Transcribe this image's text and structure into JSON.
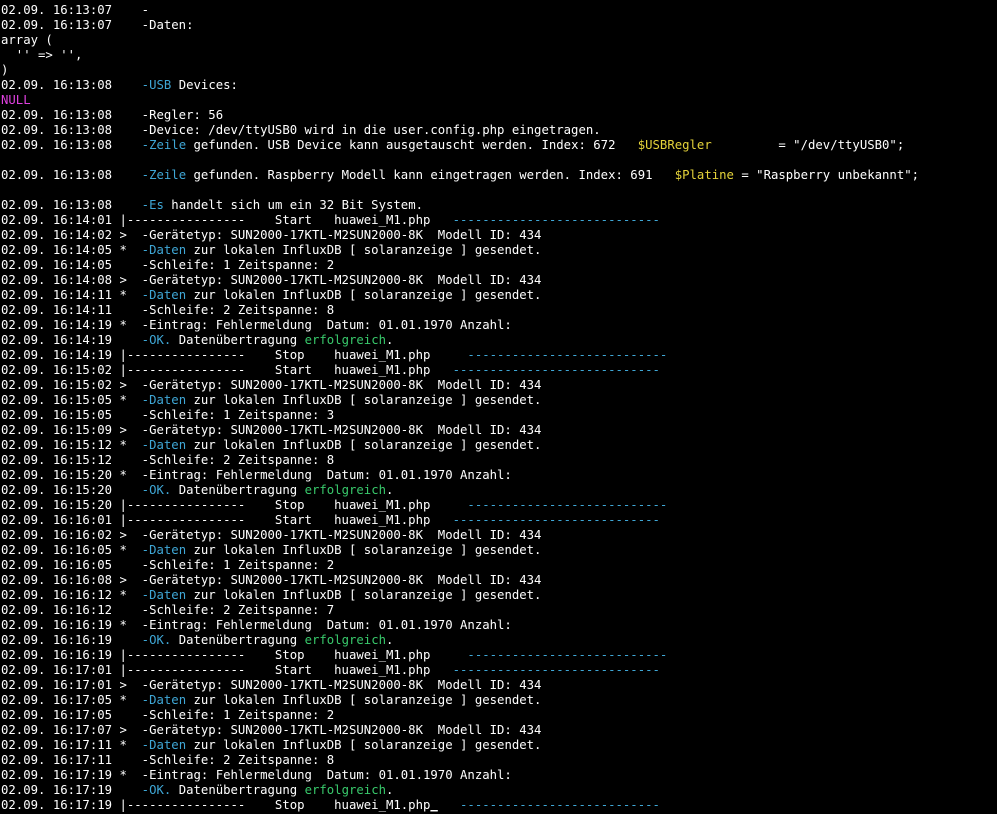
{
  "colors": {
    "background": "#000000",
    "text": "#ffffff",
    "cyan": "#3fa7d6",
    "green": "#38c96b",
    "yellow": "#e5d33a",
    "magenta": "#e040e0"
  },
  "lines": [
    [
      [
        "02.09. 16:13:07    -",
        "white"
      ]
    ],
    [
      [
        "02.09. 16:13:07    -Daten:",
        "white"
      ]
    ],
    [
      [
        "array (",
        "white"
      ]
    ],
    [
      [
        "  '' => '',",
        "white"
      ]
    ],
    [
      [
        ")",
        "white"
      ]
    ],
    [
      [
        "02.09. 16:13:08    ",
        "white"
      ],
      [
        "-USB",
        "cyan"
      ],
      [
        " Devices:",
        "white"
      ]
    ],
    [
      [
        "NULL",
        "magenta"
      ]
    ],
    [
      [
        "02.09. 16:13:08    -Regler: 56",
        "white"
      ]
    ],
    [
      [
        "02.09. 16:13:08    -Device: /dev/ttyUSB0 wird in die user.config.php eingetragen.",
        "white"
      ]
    ],
    [
      [
        "02.09. 16:13:08    ",
        "white"
      ],
      [
        "-Zeile",
        "cyan"
      ],
      [
        " gefunden. USB Device kann ausgetauscht werden. Index: 672   ",
        "white"
      ],
      [
        "$USBRegler",
        "yellow"
      ],
      [
        "         = \"/dev/ttyUSB0\";",
        "white"
      ]
    ],
    [
      [
        "",
        "white"
      ]
    ],
    [
      [
        "02.09. 16:13:08    ",
        "white"
      ],
      [
        "-Zeile",
        "cyan"
      ],
      [
        " gefunden. Raspberry Modell kann eingetragen werden. Index: 691   ",
        "white"
      ],
      [
        "$Platine",
        "yellow"
      ],
      [
        " = \"Raspberry unbekannt\";",
        "white"
      ]
    ],
    [
      [
        "",
        "white"
      ]
    ],
    [
      [
        "02.09. 16:13:08    ",
        "white"
      ],
      [
        "-Es",
        "cyan"
      ],
      [
        " handelt sich um ein 32 Bit System.",
        "white"
      ]
    ],
    [
      [
        "02.09. 16:14:01 |----------------    Start   huawei_M1.php   ",
        "white"
      ],
      [
        "----------------------------",
        "cyan"
      ]
    ],
    [
      [
        "02.09. 16:14:02 >  -Gerätetyp: SUN2000-17KTL-M2SUN2000-8K  Modell ID: 434",
        "white"
      ]
    ],
    [
      [
        "02.09. 16:14:05 *  ",
        "white"
      ],
      [
        "-Daten",
        "cyan"
      ],
      [
        " zur lokalen InfluxDB [ solaranzeige ] gesendet.",
        "white"
      ]
    ],
    [
      [
        "02.09. 16:14:05    -Schleife: 1 Zeitspanne: 2",
        "white"
      ]
    ],
    [
      [
        "02.09. 16:14:08 >  -Gerätetyp: SUN2000-17KTL-M2SUN2000-8K  Modell ID: 434",
        "white"
      ]
    ],
    [
      [
        "02.09. 16:14:11 *  ",
        "white"
      ],
      [
        "-Daten",
        "cyan"
      ],
      [
        " zur lokalen InfluxDB [ solaranzeige ] gesendet.",
        "white"
      ]
    ],
    [
      [
        "02.09. 16:14:11    -Schleife: 2 Zeitspanne: 8",
        "white"
      ]
    ],
    [
      [
        "02.09. 16:14:19 *  -Eintrag: Fehlermeldung  Datum: 01.01.1970 Anzahl:",
        "white"
      ]
    ],
    [
      [
        "02.09. 16:14:19    ",
        "white"
      ],
      [
        "-OK.",
        "cyan"
      ],
      [
        " Datenübertragung ",
        "white"
      ],
      [
        "erfolgreich",
        "green"
      ],
      [
        ".",
        "white"
      ]
    ],
    [
      [
        "02.09. 16:14:19 |----------------    Stop    huawei_M1.php     ",
        "white"
      ],
      [
        "---------------------------",
        "cyan"
      ]
    ],
    [
      [
        "02.09. 16:15:02 |----------------    Start   huawei_M1.php   ",
        "white"
      ],
      [
        "----------------------------",
        "cyan"
      ]
    ],
    [
      [
        "02.09. 16:15:02 >  -Gerätetyp: SUN2000-17KTL-M2SUN2000-8K  Modell ID: 434",
        "white"
      ]
    ],
    [
      [
        "02.09. 16:15:05 *  ",
        "white"
      ],
      [
        "-Daten",
        "cyan"
      ],
      [
        " zur lokalen InfluxDB [ solaranzeige ] gesendet.",
        "white"
      ]
    ],
    [
      [
        "02.09. 16:15:05    -Schleife: 1 Zeitspanne: 3",
        "white"
      ]
    ],
    [
      [
        "02.09. 16:15:09 >  -Gerätetyp: SUN2000-17KTL-M2SUN2000-8K  Modell ID: 434",
        "white"
      ]
    ],
    [
      [
        "02.09. 16:15:12 *  ",
        "white"
      ],
      [
        "-Daten",
        "cyan"
      ],
      [
        " zur lokalen InfluxDB [ solaranzeige ] gesendet.",
        "white"
      ]
    ],
    [
      [
        "02.09. 16:15:12    -Schleife: 2 Zeitspanne: 8",
        "white"
      ]
    ],
    [
      [
        "02.09. 16:15:20 *  -Eintrag: Fehlermeldung  Datum: 01.01.1970 Anzahl:",
        "white"
      ]
    ],
    [
      [
        "02.09. 16:15:20    ",
        "white"
      ],
      [
        "-OK.",
        "cyan"
      ],
      [
        " Datenübertragung ",
        "white"
      ],
      [
        "erfolgreich",
        "green"
      ],
      [
        ".",
        "white"
      ]
    ],
    [
      [
        "02.09. 16:15:20 |----------------    Stop    huawei_M1.php     ",
        "white"
      ],
      [
        "---------------------------",
        "cyan"
      ]
    ],
    [
      [
        "02.09. 16:16:01 |----------------    Start   huawei_M1.php   ",
        "white"
      ],
      [
        "----------------------------",
        "cyan"
      ]
    ],
    [
      [
        "02.09. 16:16:02 >  -Gerätetyp: SUN2000-17KTL-M2SUN2000-8K  Modell ID: 434",
        "white"
      ]
    ],
    [
      [
        "02.09. 16:16:05 *  ",
        "white"
      ],
      [
        "-Daten",
        "cyan"
      ],
      [
        " zur lokalen InfluxDB [ solaranzeige ] gesendet.",
        "white"
      ]
    ],
    [
      [
        "02.09. 16:16:05    -Schleife: 1 Zeitspanne: 2",
        "white"
      ]
    ],
    [
      [
        "02.09. 16:16:08 >  -Gerätetyp: SUN2000-17KTL-M2SUN2000-8K  Modell ID: 434",
        "white"
      ]
    ],
    [
      [
        "02.09. 16:16:12 *  ",
        "white"
      ],
      [
        "-Daten",
        "cyan"
      ],
      [
        " zur lokalen InfluxDB [ solaranzeige ] gesendet.",
        "white"
      ]
    ],
    [
      [
        "02.09. 16:16:12    -Schleife: 2 Zeitspanne: 7",
        "white"
      ]
    ],
    [
      [
        "02.09. 16:16:19 *  -Eintrag: Fehlermeldung  Datum: 01.01.1970 Anzahl:",
        "white"
      ]
    ],
    [
      [
        "02.09. 16:16:19    ",
        "white"
      ],
      [
        "-OK.",
        "cyan"
      ],
      [
        " Datenübertragung ",
        "white"
      ],
      [
        "erfolgreich",
        "green"
      ],
      [
        ".",
        "white"
      ]
    ],
    [
      [
        "02.09. 16:16:19 |----------------    Stop    huawei_M1.php     ",
        "white"
      ],
      [
        "---------------------------",
        "cyan"
      ]
    ],
    [
      [
        "02.09. 16:17:01 |----------------    Start   huawei_M1.php   ",
        "white"
      ],
      [
        "----------------------------",
        "cyan"
      ]
    ],
    [
      [
        "02.09. 16:17:01 >  -Gerätetyp: SUN2000-17KTL-M2SUN2000-8K  Modell ID: 434",
        "white"
      ]
    ],
    [
      [
        "02.09. 16:17:05 *  ",
        "white"
      ],
      [
        "-Daten",
        "cyan"
      ],
      [
        " zur lokalen InfluxDB [ solaranzeige ] gesendet.",
        "white"
      ]
    ],
    [
      [
        "02.09. 16:17:05    -Schleife: 1 Zeitspanne: 2",
        "white"
      ]
    ],
    [
      [
        "02.09. 16:17:07 >  -Gerätetyp: SUN2000-17KTL-M2SUN2000-8K  Modell ID: 434",
        "white"
      ]
    ],
    [
      [
        "02.09. 16:17:11 *  ",
        "white"
      ],
      [
        "-Daten",
        "cyan"
      ],
      [
        " zur lokalen InfluxDB [ solaranzeige ] gesendet.",
        "white"
      ]
    ],
    [
      [
        "02.09. 16:17:11    -Schleife: 2 Zeitspanne: 8",
        "white"
      ]
    ],
    [
      [
        "02.09. 16:17:19 *  -Eintrag: Fehlermeldung  Datum: 01.01.1970 Anzahl:",
        "white"
      ]
    ],
    [
      [
        "02.09. 16:17:19    ",
        "white"
      ],
      [
        "-OK.",
        "cyan"
      ],
      [
        " Datenübertragung ",
        "white"
      ],
      [
        "erfolgreich",
        "green"
      ],
      [
        ".",
        "white"
      ]
    ],
    [
      [
        "02.09. 16:17:19 |----------------    Stop    huawei_M1.php",
        "white"
      ],
      [
        "_",
        "cursor"
      ],
      [
        "   ",
        "white"
      ],
      [
        "---------------------------",
        "cyan"
      ]
    ]
  ]
}
